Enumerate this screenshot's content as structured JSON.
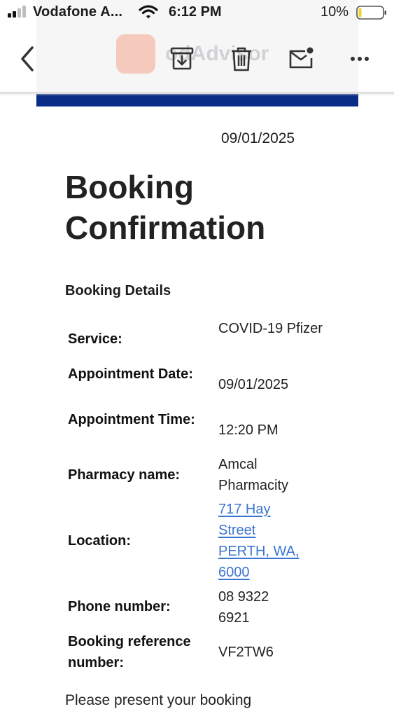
{
  "status_bar": {
    "carrier": "Vodafone A...",
    "time": "6:12 PM",
    "battery": "10%"
  },
  "toolbar": {
    "icons": [
      "back-chevron-icon",
      "archive-icon",
      "trash-icon",
      "mark-unread-icon",
      "more-icon"
    ],
    "banner_brand": "odAdvisor"
  },
  "email": {
    "date": "09/01/2025",
    "title": "Booking Confirmation",
    "section_heading": "Booking Details",
    "details": [
      {
        "label": "Service:",
        "value": "COVID-19 Pfizer"
      },
      {
        "label": "Appointment Date:",
        "value": "09/01/2025"
      },
      {
        "label": "Appointment Time:",
        "value": "12:20 PM"
      },
      {
        "label": "Pharmacy name:",
        "value": "Amcal Pharmacity"
      },
      {
        "label": "Location:",
        "value": "717 Hay Street PERTH, WA, 6000"
      },
      {
        "label": "Phone number:",
        "value": "08 9322 6921"
      },
      {
        "label": "Booking reference number:",
        "value": "VF2TW6"
      }
    ],
    "footer": "Please present your booking"
  },
  "colors": {
    "link": "#3b75d0",
    "banner_stripe": "#0a2b86",
    "battery_low": "#f2d22e"
  }
}
